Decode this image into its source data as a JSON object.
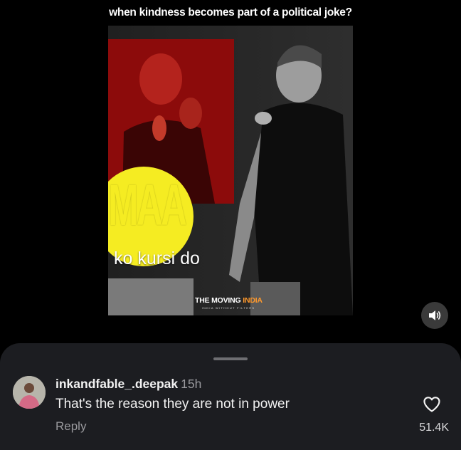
{
  "post": {
    "caption": "when kindness becomes part of a political joke?"
  },
  "video": {
    "overlay_big_text": "MAA",
    "overlay_subtitle": "ko kursi do",
    "brand_prefix": "THE MOVING ",
    "brand_suffix": "INDIA",
    "brand_tagline": "INDIA WITHOUT FILTERS",
    "accent_yellow": "#f5ec22",
    "accent_red": "#8c0b0b",
    "sound_icon": "speaker-icon"
  },
  "comments": {
    "items": [
      {
        "username": "inkandfable_.deepak",
        "time": "15h",
        "text": "That's the reason they are not in power",
        "reply_label": "Reply",
        "like_count": "51.4K",
        "like_icon": "heart-icon"
      }
    ]
  }
}
